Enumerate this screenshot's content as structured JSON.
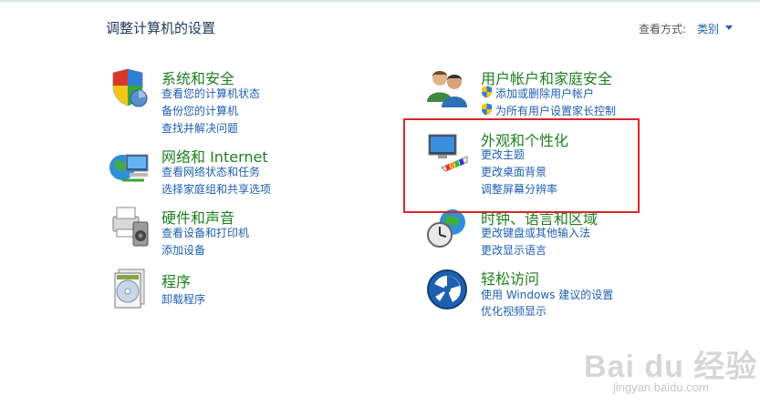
{
  "header": {
    "title": "调整计算机的设置",
    "view_by_label": "查看方式:",
    "view_by_value": "类别"
  },
  "categories": [
    {
      "title": "系统和安全",
      "icon": "shield-icon",
      "links": [
        "查看您的计算机状态",
        "备份您的计算机",
        "查找并解决问题"
      ]
    },
    {
      "title": "网络和 Internet",
      "icon": "network-globe-icon",
      "links": [
        "查看网络状态和任务",
        "选择家庭组和共享选项"
      ]
    },
    {
      "title": "硬件和声音",
      "icon": "printer-speaker-icon",
      "links": [
        "查看设备和打印机",
        "添加设备"
      ]
    },
    {
      "title": "程序",
      "icon": "programs-disc-icon",
      "links": [
        "卸载程序"
      ]
    },
    {
      "title": "用户帐户和家庭安全",
      "icon": "users-icon",
      "links": [
        "添加或删除用户帐户",
        "为所有用户设置家长控制"
      ]
    },
    {
      "title": "外观和个性化",
      "icon": "monitor-palette-icon",
      "links": [
        "更改主题",
        "更改桌面背景",
        "调整屏幕分辨率"
      ]
    },
    {
      "title": "时钟、语言和区域",
      "icon": "clock-globe-icon",
      "links": [
        "更改键盘或其他输入法",
        "更改显示语言"
      ]
    },
    {
      "title": "轻松访问",
      "icon": "ease-of-access-icon",
      "links": [
        "使用 Windows 建议的设置",
        "优化视频显示"
      ]
    }
  ],
  "highlight_color": "#d8262b",
  "watermark": {
    "big": "Bai du 经验",
    "small": "jingyan.baidu.com"
  }
}
